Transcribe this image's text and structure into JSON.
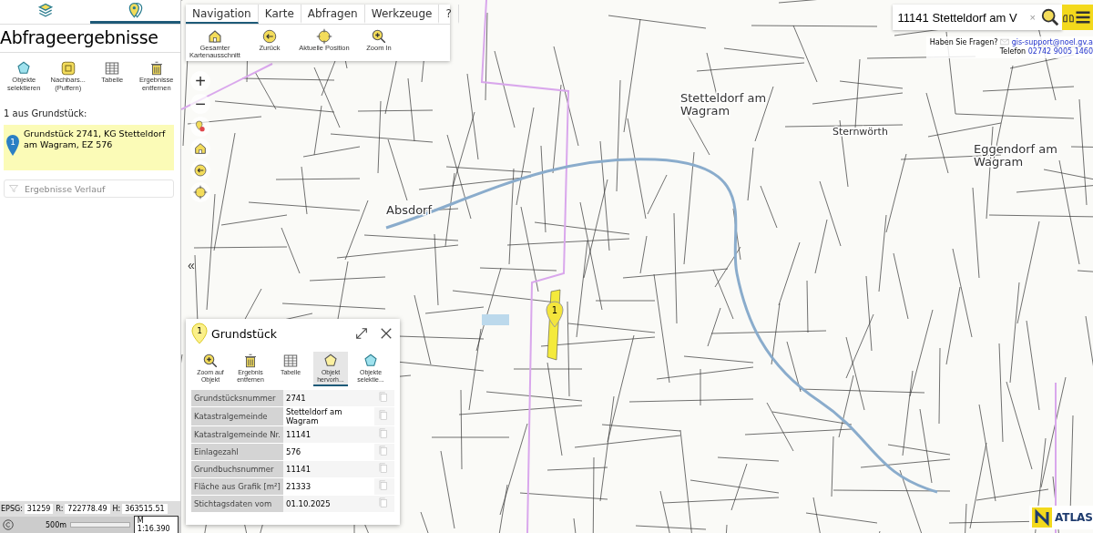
{
  "sidebar": {
    "tabs": [
      {
        "kind": "layers",
        "selected": false
      },
      {
        "kind": "pins",
        "selected": true
      }
    ],
    "title": "Abfrageergebnisse",
    "tools": [
      {
        "kind": "select",
        "label": "Objekte selektieren"
      },
      {
        "kind": "buffer",
        "label": "Nachbars... (Puffern)"
      },
      {
        "kind": "table",
        "label": "Tabelle"
      },
      {
        "kind": "trash",
        "label": "Ergebnisse entfernen"
      }
    ],
    "result_count": "1 aus Grundstück:",
    "results": [
      {
        "number": "1",
        "text": "Grundstück 2741, KG Stetteldorf am Wagram, EZ 576",
        "selected": true
      }
    ],
    "history": {
      "label": "Ergebnisse Verlauf",
      "expanded": false
    },
    "coords": [
      {
        "label": "EPSG:",
        "value": "31259"
      },
      {
        "label": "R:",
        "value": "722778.49"
      },
      {
        "label": "H:",
        "value": "363515.51"
      }
    ],
    "scale_bar": "500m",
    "scale": "M 1:16.390"
  },
  "map": {
    "labels": [
      {
        "text": "Stetteldorf am Wagram",
        "kind": "town"
      },
      {
        "text": "Absdorf",
        "kind": "town"
      },
      {
        "text": "Sternwörth",
        "kind": "village"
      },
      {
        "text": "Eggendorf am Wagram",
        "kind": "town"
      }
    ],
    "marker": "1",
    "collapse": "«",
    "zoom_in": "+",
    "zoom_out": "−",
    "side_tools": [
      {
        "kind": "pin"
      },
      {
        "kind": "home"
      },
      {
        "kind": "back"
      },
      {
        "kind": "position"
      }
    ],
    "ribbon": {
      "tabs": [
        {
          "label": "Navigation",
          "selected": true
        },
        {
          "label": "Karte",
          "selected": false
        },
        {
          "label": "Abfragen",
          "selected": false
        },
        {
          "label": "Werkzeuge",
          "selected": false
        },
        {
          "label": "?",
          "selected": false
        }
      ],
      "tools": [
        {
          "kind": "home",
          "label": "Gesamter Kartenausschnitt"
        },
        {
          "kind": "back",
          "label": "Zurück"
        },
        {
          "kind": "position",
          "label": "Aktuelle Position"
        },
        {
          "kind": "zoom",
          "label": "Zoom In"
        }
      ]
    },
    "search": {
      "value": "11141 Stetteldorf am V",
      "clear": "×"
    },
    "help": {
      "question": "Haben Sie Fragen?",
      "email": "gis-support@noel.gv.a",
      "phone_label": "Telefon",
      "phone": "02742 9005 1460"
    },
    "logo": "ATLAS"
  },
  "popup": {
    "badge": "1",
    "title": "Grundstück",
    "tools": [
      {
        "kind": "zoom",
        "label": "Zoom auf Objekt",
        "selected": false
      },
      {
        "kind": "trash",
        "label": "Ergebnis entfernen",
        "selected": false
      },
      {
        "kind": "table",
        "label": "Tabelle",
        "selected": false
      },
      {
        "kind": "highlight",
        "label": "Objekt hervorh...",
        "selected": true
      },
      {
        "kind": "select",
        "label": "Objekte selektie...",
        "selected": false
      }
    ],
    "rows": [
      {
        "label": "Grundstücksnummer",
        "value": "2741"
      },
      {
        "label": "Katastralgemeinde",
        "value": "Stetteldorf am Wagram"
      },
      {
        "label": "Katastralgemeinde Nr.",
        "value": "11141"
      },
      {
        "label": "Einlagezahl",
        "value": "576"
      },
      {
        "label": "Grundbuchsnummer",
        "value": "11141"
      },
      {
        "label": "Fläche aus Grafik [m²]",
        "value": "21333"
      },
      {
        "label": "Stichtagsdaten vom",
        "value": "01.10.2025"
      }
    ]
  }
}
